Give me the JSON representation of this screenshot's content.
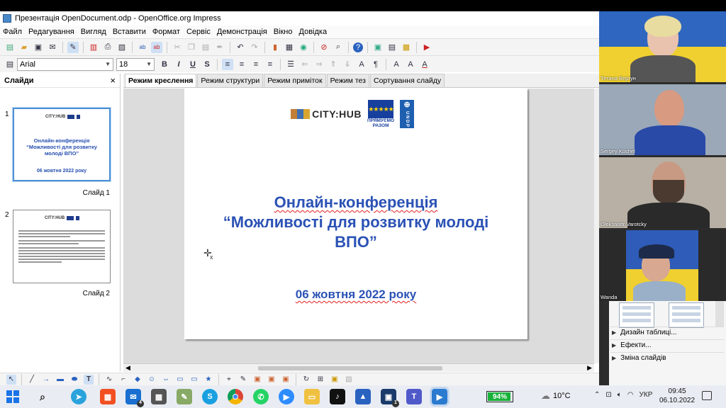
{
  "window": {
    "title": "Презентація OpenDocument.odp - OpenOffice.org Impress"
  },
  "menu": [
    "Файл",
    "Редагування",
    "Вигляд",
    "Вставити",
    "Формат",
    "Сервіс",
    "Демонстрація",
    "Вікно",
    "Довідка"
  ],
  "format_toolbar": {
    "font_name": "Arial",
    "font_size": "18",
    "bold": "B",
    "italic": "I",
    "underline": "U",
    "shadow": "S"
  },
  "slides_pane": {
    "title": "Слайди",
    "close": "×",
    "slides": [
      {
        "number": "1",
        "label": "Слайд 1",
        "title": "Онлайн-конференція “Можливості для розвитку молоді ВПО”",
        "date": "06 жовтня 2022 року",
        "logo_text": "CITY:HUB"
      },
      {
        "number": "2",
        "label": "Слайд 2",
        "logo_text": "CITY:HUB"
      }
    ]
  },
  "view_tabs": [
    "Режим креслення",
    "Режим структури",
    "Режим приміток",
    "Режим тез",
    "Сортування слайду"
  ],
  "slide": {
    "logo_city": "CITY:HUB",
    "eu_stars": "★★★★★",
    "eu_label_1": "ПРЯМУЄМО",
    "eu_label_2": "РАЗОМ",
    "undp": "U N D P",
    "undp_glyph": "⊕",
    "title_line1": "Онлайн-конференція",
    "title_line2": "“Можливості для розвитку молоді",
    "title_line3": "ВПО”",
    "date": "06 жовтня 2022 року",
    "cursor": "✛",
    "cursor_sub": "x"
  },
  "side_panel": {
    "items": [
      "Дизайн таблиці...",
      "Ефекти...",
      "Зміна слайдів"
    ]
  },
  "participants": [
    {
      "name": "Тетяна Вергун"
    },
    {
      "name": "Sergey Koshel"
    },
    {
      "name": "Oleksandr Varotcky"
    },
    {
      "name": "Wanda"
    }
  ],
  "taskbar": {
    "battery": "94%",
    "battery_level": 0.94,
    "weather": "10°C",
    "lang": "УКР",
    "time": "09:45",
    "date": "06.10.2022",
    "badges": {
      "mail": "4",
      "teams": "1"
    }
  },
  "colors": {
    "accent": "#2b52b5",
    "selection": "#4d8fd6"
  }
}
